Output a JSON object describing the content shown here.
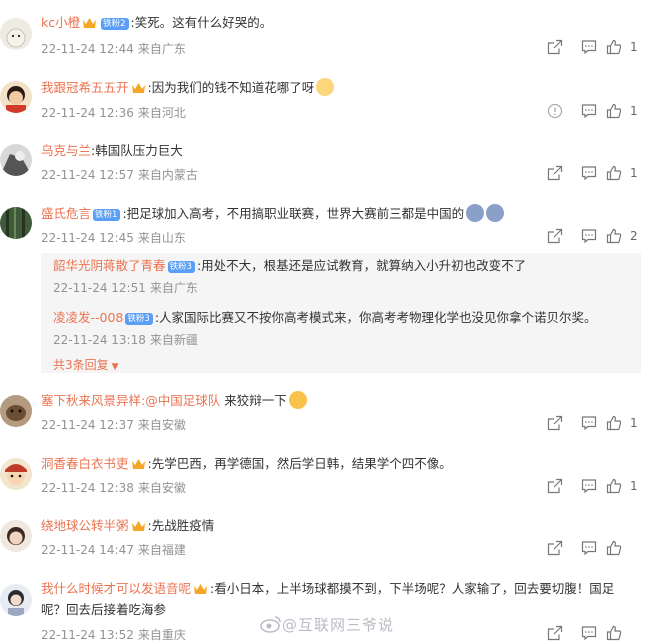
{
  "comments": [
    {
      "user": "kc小橙",
      "badge": "铁粉2",
      "text": ":笑死。这有什么好哭的。",
      "time": "22-11-24 12:44",
      "location": "来自广东",
      "likes": "1"
    },
    {
      "user": "我跟冠希五五开",
      "text": ":因为我们的钱不知道花哪了呀",
      "time": "22-11-24 12:36",
      "location": "来自河北",
      "likes": "1"
    },
    {
      "user": "乌克与兰",
      "text": ":韩国队压力巨大",
      "time": "22-11-24 12:57",
      "location": "来自内蒙古",
      "likes": "1"
    },
    {
      "user": "盛氏危言",
      "badge": "铁粉1",
      "text": ":把足球加入高考，不用搞职业联赛，世界大赛前三都是中国的",
      "time": "22-11-24 12:45",
      "location": "来自山东",
      "likes": "2",
      "replies": [
        {
          "user": "韶华光阴蒋散了青春",
          "badge": "铁粉3",
          "text": ":用处不大，根基还是应试教育，就算纳入小升初也改变不了",
          "time": "22-11-24 12:51",
          "location": "来自广东"
        },
        {
          "user": "凌凌发--008",
          "badge": "铁粉3",
          "text": ":人家国际比赛又不按你高考模式来，你高考考物理化学也没见你拿个诺贝尔奖。",
          "time": "22-11-24 13:18",
          "location": "来自新疆"
        }
      ],
      "more_replies": "共3条回复"
    },
    {
      "user": "塞下秋来风景异样",
      "mention": ":@中国足球队",
      "text": " 来狡辩一下",
      "time": "22-11-24 12:37",
      "location": "来自安徽",
      "likes": "1"
    },
    {
      "user": "洞香春白衣书吏",
      "text": ":先学巴西，再学德国，然后学日韩，结果学个四不像。",
      "time": "22-11-24 12:38",
      "location": "来自安徽",
      "likes": "1"
    },
    {
      "user": "绕地球公转半粥",
      "text": ":先战胜疫情",
      "time": "22-11-24 14:47",
      "location": "来自福建",
      "likes": ""
    },
    {
      "user": "我什么时候才可以发语音呢",
      "text": ":看小日本，上半场球都摸不到，下半场呢？人家输了，回去要切腹！国足呢？回去后接着吃海参",
      "time": "22-11-24 13:52",
      "location": "来自重庆",
      "likes": ""
    }
  ],
  "watermark": "@互联网三爷说",
  "colors": {
    "username": "#eb7350",
    "meta": "#939393",
    "badge": "#5a9ff5",
    "reply_bg": "#f5f5f5"
  },
  "icons": [
    "share-icon",
    "comment-icon",
    "like-icon",
    "report-icon"
  ]
}
